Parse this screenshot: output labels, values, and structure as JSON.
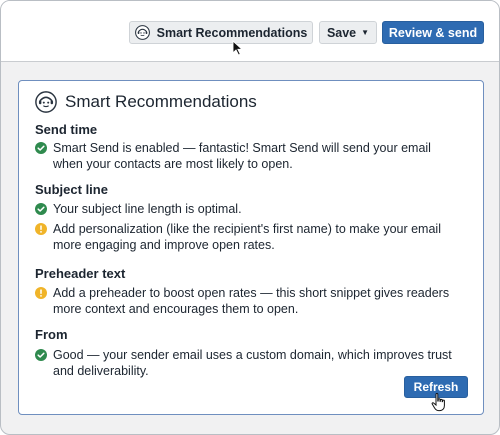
{
  "toolbar": {
    "smart_label": "Smart Recommendations",
    "save_label": "Save",
    "review_label": "Review & send"
  },
  "panel": {
    "title": "Smart Recommendations",
    "sections": [
      {
        "heading": "Send time",
        "items": [
          {
            "status": "success",
            "text": "Smart Send is enabled — fantastic! Smart Send will send your email when your contacts are most likely to open."
          }
        ]
      },
      {
        "heading": "Subject line",
        "items": [
          {
            "status": "success",
            "text": "Your subject line length is optimal."
          },
          {
            "status": "warning",
            "text": "Add personalization (like the recipient's first name) to make your email more engaging and improve open rates."
          }
        ]
      },
      {
        "heading": "Preheader text",
        "items": [
          {
            "status": "warning",
            "text": "Add a preheader to boost open rates — this short snippet gives readers more context and encourages them to open."
          }
        ]
      },
      {
        "heading": "From",
        "items": [
          {
            "status": "success",
            "text": "Good — your sender email uses a custom domain, which improves trust and deliverability."
          }
        ]
      }
    ],
    "refresh_label": "Refresh"
  },
  "icons": {
    "success": "check-circle-icon",
    "warning": "warning-circle-icon"
  },
  "colors": {
    "primary": "#2e6bb2",
    "success": "#2f8a4e",
    "warning": "#f0b429",
    "panel_border": "#6f8fbf"
  }
}
